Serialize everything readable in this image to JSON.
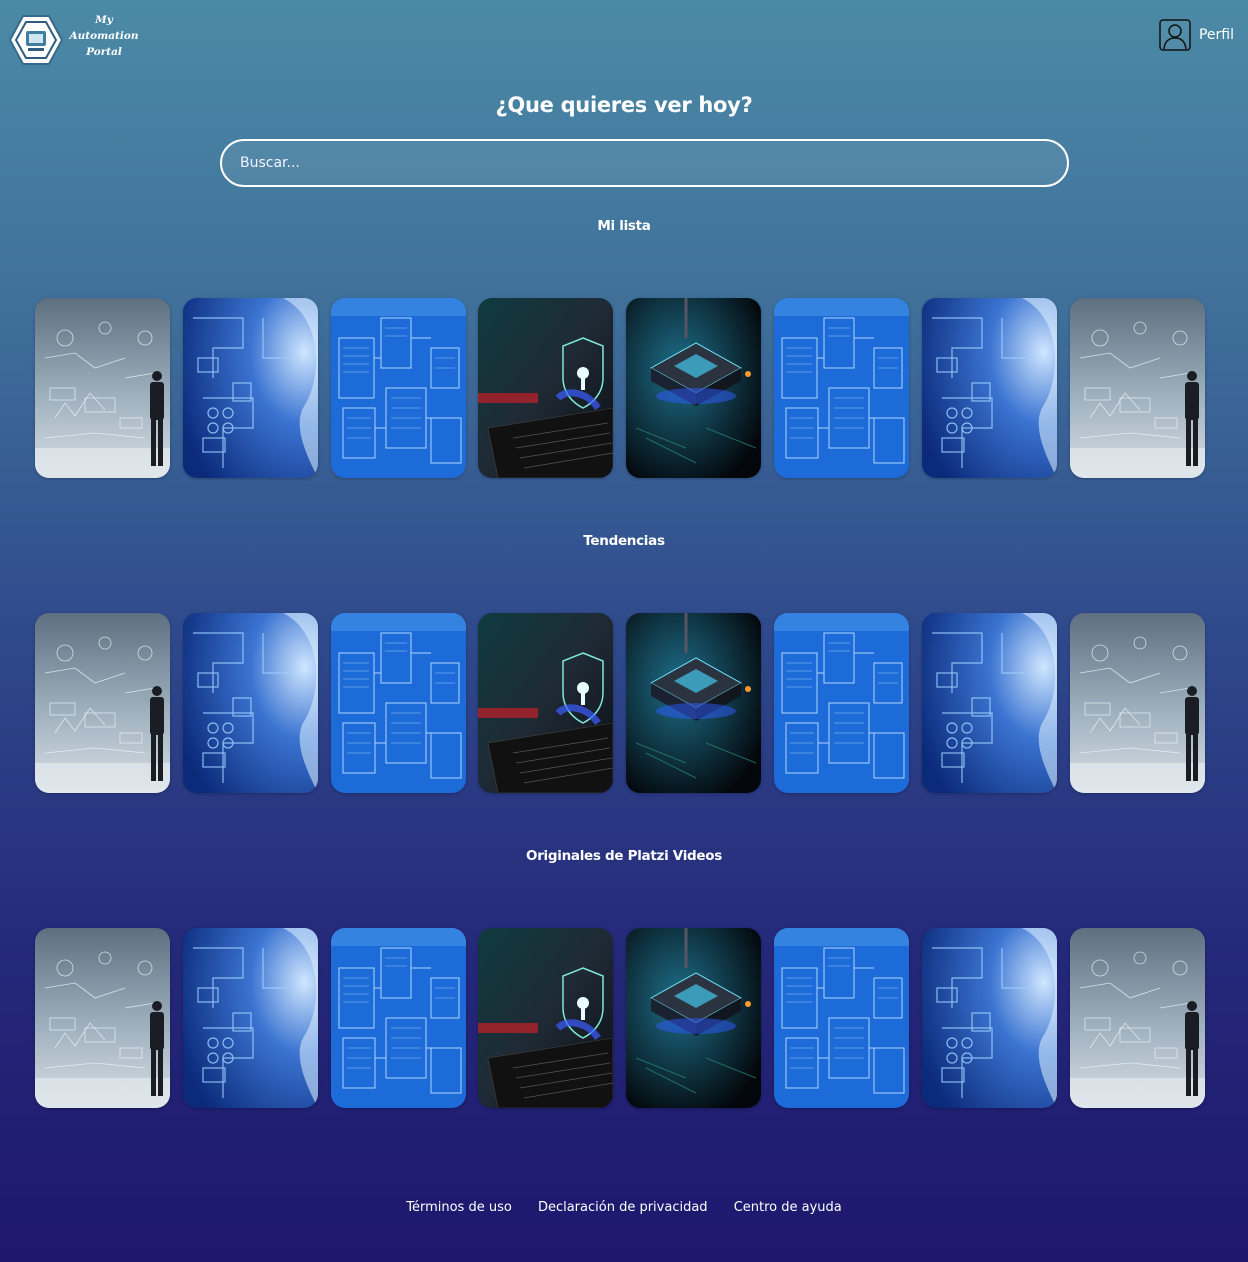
{
  "header": {
    "logo_line1": "My Automation",
    "logo_line2": "Portal",
    "profile_label": "Perfil"
  },
  "page_title": "¿Que quieres ver hoy?",
  "search": {
    "placeholder": "Buscar...",
    "value": ""
  },
  "sections": [
    {
      "title": "Mi lista",
      "items": [
        "businessman-sketch",
        "circuit-head",
        "blue-diagram",
        "laptop-shield",
        "cpu-chip",
        "blue-diagram",
        "circuit-head",
        "businessman-sketch"
      ]
    },
    {
      "title": "Tendencias",
      "items": [
        "businessman-sketch",
        "circuit-head",
        "blue-diagram",
        "laptop-shield",
        "cpu-chip",
        "blue-diagram",
        "circuit-head",
        "businessman-sketch"
      ]
    },
    {
      "title": "Originales de Platzi Videos",
      "items": [
        "businessman-sketch",
        "circuit-head",
        "blue-diagram",
        "laptop-shield",
        "cpu-chip",
        "blue-diagram",
        "circuit-head",
        "businessman-sketch"
      ]
    }
  ],
  "footer": {
    "links": [
      "Términos de uso",
      "Declaración de privacidad",
      "Centro de ayuda"
    ]
  }
}
